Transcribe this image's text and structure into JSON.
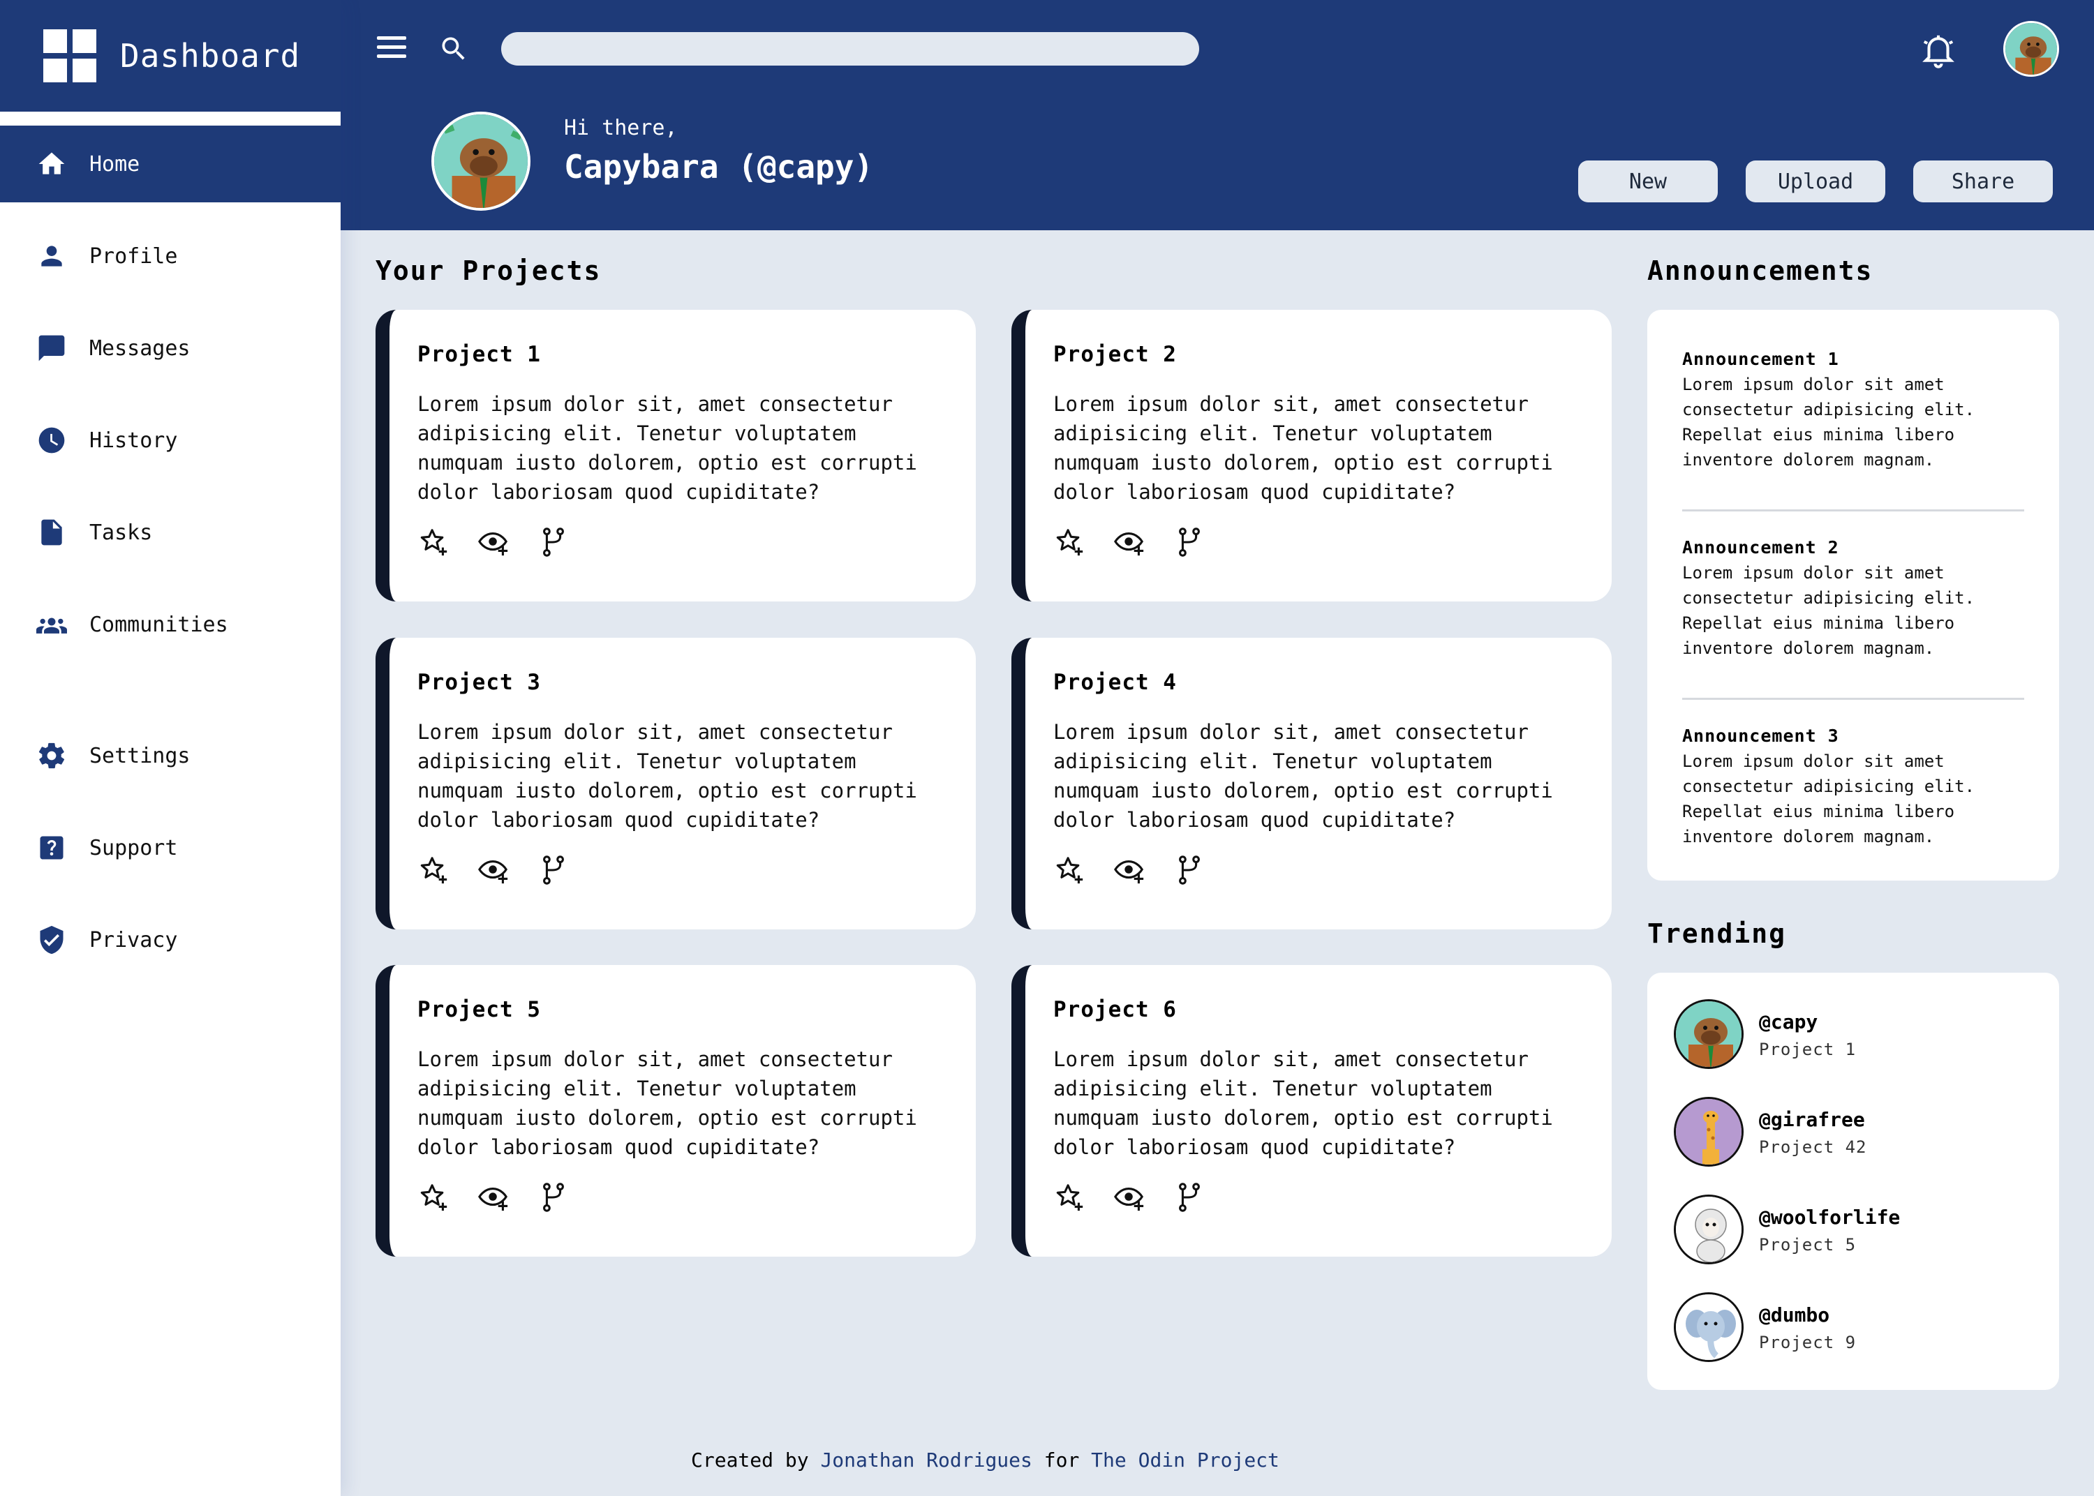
{
  "brand": {
    "title": "Dashboard"
  },
  "sidebar": {
    "items": [
      {
        "label": "Home",
        "icon": "home-icon",
        "active": true
      },
      {
        "label": "Profile",
        "icon": "person-icon"
      },
      {
        "label": "Messages",
        "icon": "chat-icon"
      },
      {
        "label": "History",
        "icon": "clock-icon"
      },
      {
        "label": "Tasks",
        "icon": "document-icon"
      },
      {
        "label": "Communities",
        "icon": "group-icon"
      },
      {
        "label": "Settings",
        "icon": "gear-icon"
      },
      {
        "label": "Support",
        "icon": "help-icon"
      },
      {
        "label": "Privacy",
        "icon": "shield-icon"
      }
    ]
  },
  "header": {
    "search_value": "",
    "greeting": "Hi there,",
    "user_name": "Capybara (@capy)",
    "buttons": {
      "new": "New",
      "upload": "Upload",
      "share": "Share"
    }
  },
  "projects": {
    "title": "Your Projects",
    "items": [
      {
        "name": "Project 1",
        "description": "Lorem ipsum dolor sit, amet consectetur adipisicing elit. Tenetur voluptatem numquam iusto dolorem, optio est corrupti dolor laboriosam quod cupiditate?"
      },
      {
        "name": "Project 2",
        "description": "Lorem ipsum dolor sit, amet consectetur adipisicing elit. Tenetur voluptatem numquam iusto dolorem, optio est corrupti dolor laboriosam quod cupiditate?"
      },
      {
        "name": "Project 3",
        "description": "Lorem ipsum dolor sit, amet consectetur adipisicing elit. Tenetur voluptatem numquam iusto dolorem, optio est corrupti dolor laboriosam quod cupiditate?"
      },
      {
        "name": "Project 4",
        "description": "Lorem ipsum dolor sit, amet consectetur adipisicing elit. Tenetur voluptatem numquam iusto dolorem, optio est corrupti dolor laboriosam quod cupiditate?"
      },
      {
        "name": "Project 5",
        "description": "Lorem ipsum dolor sit, amet consectetur adipisicing elit. Tenetur voluptatem numquam iusto dolorem, optio est corrupti dolor laboriosam quod cupiditate?"
      },
      {
        "name": "Project 6",
        "description": "Lorem ipsum dolor sit, amet consectetur adipisicing elit. Tenetur voluptatem numquam iusto dolorem, optio est corrupti dolor laboriosam quod cupiditate?"
      }
    ],
    "action_icons": [
      "star-add-icon",
      "watch-eye-icon",
      "fork-icon"
    ]
  },
  "announcements": {
    "title": "Announcements",
    "items": [
      {
        "title": "Announcement 1",
        "body": "Lorem ipsum dolor sit amet consectetur adipisicing elit. Repellat eius minima libero inventore dolorem magnam."
      },
      {
        "title": "Announcement 2",
        "body": "Lorem ipsum dolor sit amet consectetur adipisicing elit. Repellat eius minima libero inventore dolorem magnam."
      },
      {
        "title": "Announcement 3",
        "body": "Lorem ipsum dolor sit amet consectetur adipisicing elit. Repellat eius minima libero inventore dolorem magnam."
      }
    ]
  },
  "trending": {
    "title": "Trending",
    "items": [
      {
        "handle": "@capy",
        "project": "Project 1",
        "avatar": "capybara-avatar"
      },
      {
        "handle": "@girafree",
        "project": "Project 42",
        "avatar": "giraffe-avatar"
      },
      {
        "handle": "@woolforlife",
        "project": "Project 5",
        "avatar": "sheep-avatar"
      },
      {
        "handle": "@dumbo",
        "project": "Project 9",
        "avatar": "elephant-avatar"
      }
    ]
  },
  "footer": {
    "prefix": "Created by",
    "author": "Jonathan Rodrigues",
    "middle": "for",
    "org": "The Odin Project"
  },
  "colors": {
    "primary": "#1e3a78",
    "background": "#e2e8f0",
    "card_accent": "#0f172a",
    "card_bg": "#ffffff"
  }
}
